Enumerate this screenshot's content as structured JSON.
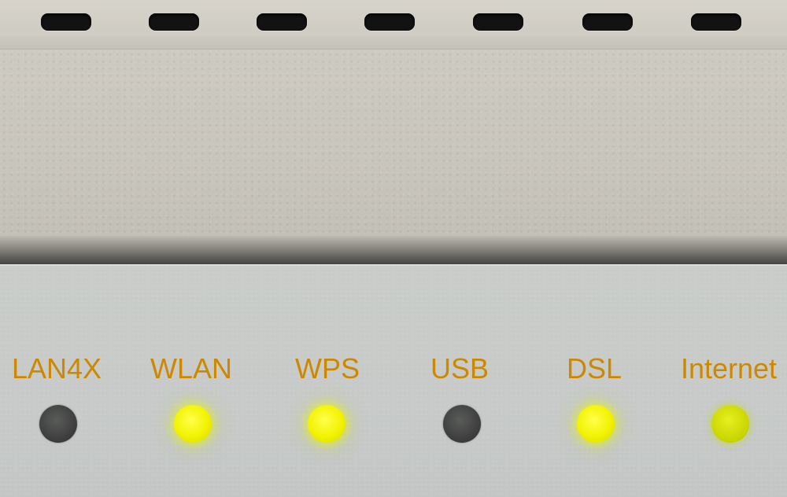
{
  "indicators": [
    {
      "label": "LAN4X",
      "state": "off"
    },
    {
      "label": "WLAN",
      "state": "on"
    },
    {
      "label": "WPS",
      "state": "on"
    },
    {
      "label": "USB",
      "state": "off"
    },
    {
      "label": "DSL",
      "state": "on"
    },
    {
      "label": "Internet",
      "state": "dim"
    }
  ],
  "colors": {
    "label": "#cc8800",
    "led_on": "#f2f200",
    "led_off": "#3a3b3a"
  }
}
